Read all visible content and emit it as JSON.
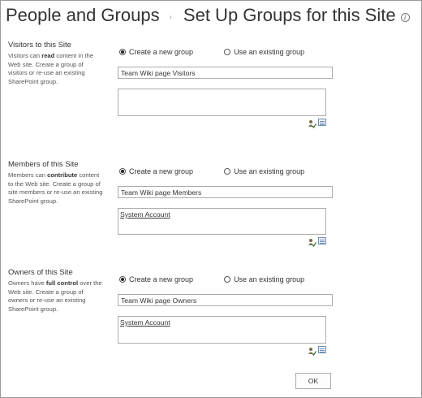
{
  "header": {
    "crumb_parent": "People and Groups",
    "crumb_separator": "›",
    "crumb_current": "Set Up Groups for this Site",
    "info_glyph": "i"
  },
  "sections": [
    {
      "title": "Visitors to this Site",
      "desc_before": "Visitors can ",
      "desc_bold": "read",
      "desc_after": " content in the Web site. Create a group of visitors or re-use an existing SharePoint group.",
      "radio_new": "Create a new group",
      "radio_existing": "Use an existing group",
      "selected": "new",
      "group_name": "Team Wiki page Visitors",
      "members": ""
    },
    {
      "title": "Members of this Site",
      "desc_before": "Members can ",
      "desc_bold": "contribute",
      "desc_after": " content to the Web site. Create a group of site members or re-use an existing SharePoint group.",
      "radio_new": "Create a new group",
      "radio_existing": "Use an existing group",
      "selected": "new",
      "group_name": "Team Wiki page Members",
      "members": "System Account"
    },
    {
      "title": "Owners of this Site",
      "desc_before": "Owners have ",
      "desc_bold": "full control",
      "desc_after": " over the Web site. Create a group of owners or re-use an existing SharePoint group.",
      "radio_new": "Create a new group",
      "radio_existing": "Use an existing group",
      "selected": "new",
      "group_name": "Team Wiki page Owners",
      "members": "System Account"
    }
  ],
  "footer": {
    "ok_label": "OK"
  },
  "icons": {
    "check_names": "check-names-icon",
    "browse": "address-book-icon"
  }
}
